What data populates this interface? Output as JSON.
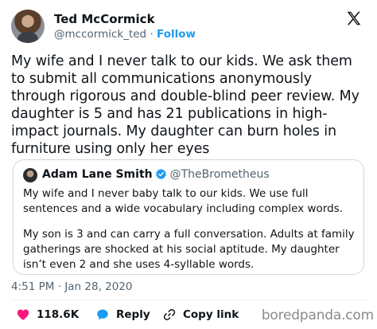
{
  "author": {
    "name": "Ted McCormick",
    "handle": "@mccormick_ted",
    "separator": "·",
    "follow_label": "Follow"
  },
  "tweet": {
    "text": "My wife and I never talk to our kids. We ask them to submit all communications anonymously through rigorous and double-blind peer review. My daughter is 5 and has 21 publications in high-impact journals. My daughter can burn holes in furniture using only her eyes",
    "time": "4:51 PM",
    "date": "Jan 28, 2020",
    "meta_separator": "·"
  },
  "quote": {
    "name": "Adam Lane Smith",
    "handle": "@TheBrometheus",
    "verified": true,
    "paragraph1": "My wife and I never baby talk to our kids. We use full sentences and a wide vocabulary including complex words.",
    "paragraph2": "My son is 3 and can carry a full conversation. Adults at family gatherings are shocked at his social aptitude. My daughter isn’t even 2 and she uses 4-syllable words."
  },
  "actions": {
    "like_count": "118.6K",
    "reply_label": "Reply",
    "copy_label": "Copy link"
  },
  "watermark": "boredpanda.com",
  "icons": {
    "like": "heart-icon",
    "reply": "speech-bubble-icon",
    "copy": "link-icon",
    "platform": "x-logo-icon",
    "verified": "verified-badge-icon"
  },
  "colors": {
    "accent": "#1d9bf0",
    "like": "#f91880",
    "muted": "#536471",
    "border": "#cfd9de"
  }
}
